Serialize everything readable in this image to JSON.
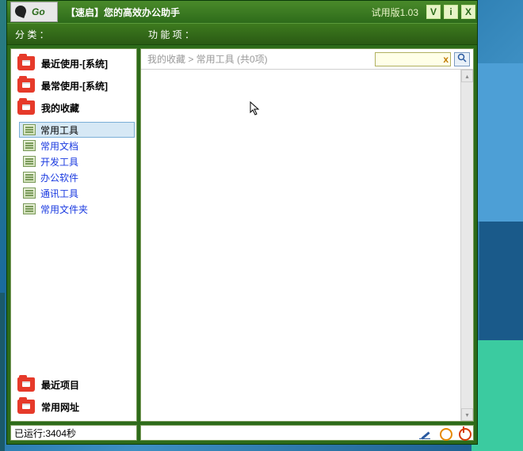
{
  "titlebar": {
    "go_label": "Go",
    "title": "【速启】您的高效办公助手",
    "version": "试用版1.03",
    "btn_v": "V",
    "btn_i": "i",
    "btn_x": "X"
  },
  "headers": {
    "category": "分 类 ：",
    "function": "功 能 项 ："
  },
  "sidebar": {
    "items": [
      {
        "label": "最近使用-[系统]"
      },
      {
        "label": "最常使用-[系统]"
      },
      {
        "label": "我的收藏"
      }
    ],
    "sub_items": [
      {
        "label": "常用工具",
        "selected": true
      },
      {
        "label": "常用文档"
      },
      {
        "label": "开发工具"
      },
      {
        "label": "办公软件"
      },
      {
        "label": "通讯工具"
      },
      {
        "label": "常用文件夹"
      }
    ],
    "bottom_items": [
      {
        "label": "最近项目"
      },
      {
        "label": "常用网址"
      }
    ]
  },
  "main": {
    "breadcrumb": "我的收藏 > 常用工具 (共0项)",
    "search_clear": "x",
    "search_icon": "🔍"
  },
  "status": {
    "runtime": "已运行:3404秒"
  }
}
